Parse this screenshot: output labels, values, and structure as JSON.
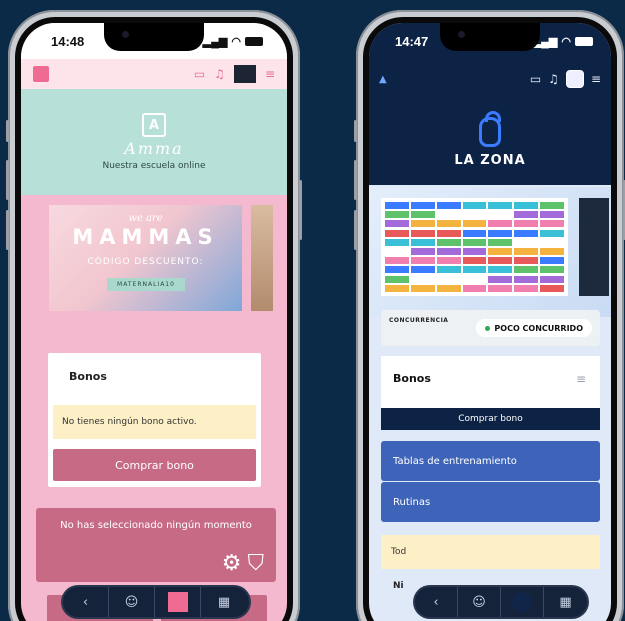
{
  "left_phone": {
    "time": "14:48",
    "brand_sub": "Nuestra escuela online",
    "brand_letter": "A",
    "brand_script": "Amma",
    "promo": {
      "we_are": "we are",
      "title": "MAMMAS",
      "codigo": "CÓDIGO DESCUENTO:",
      "code": "MATERNALIA10"
    },
    "bonos_title": "Bonos",
    "no_bono": "No tienes ningún bono activo.",
    "comprar": "Comprar bono",
    "momento": "No has seleccionado ningún momento"
  },
  "right_phone": {
    "time": "14:47",
    "brand": "LA ZONA",
    "concurrencia_label": "CONCURRENCIA",
    "concurrencia_status": "POCO CONCURRIDO",
    "bonos_title": "Bonos",
    "comprar": "Comprar bono",
    "menu": [
      "Tablas de entrenamiento",
      "Rutinas"
    ],
    "partial_text": "Tod",
    "bottom_partial": "Ni"
  },
  "colors": {
    "pink_accent": "#c76a86",
    "navy": "#0d2346",
    "blue_button": "#3e64b9",
    "mint": "#b7e0d8",
    "warning_bg": "#fdf0c7"
  },
  "icons": {
    "tab_back": "chevron-left-icon",
    "tab_community": "people-icon",
    "tab_qr": "qr-code-icon",
    "gear": "gear-icon",
    "basket": "basket-icon"
  }
}
